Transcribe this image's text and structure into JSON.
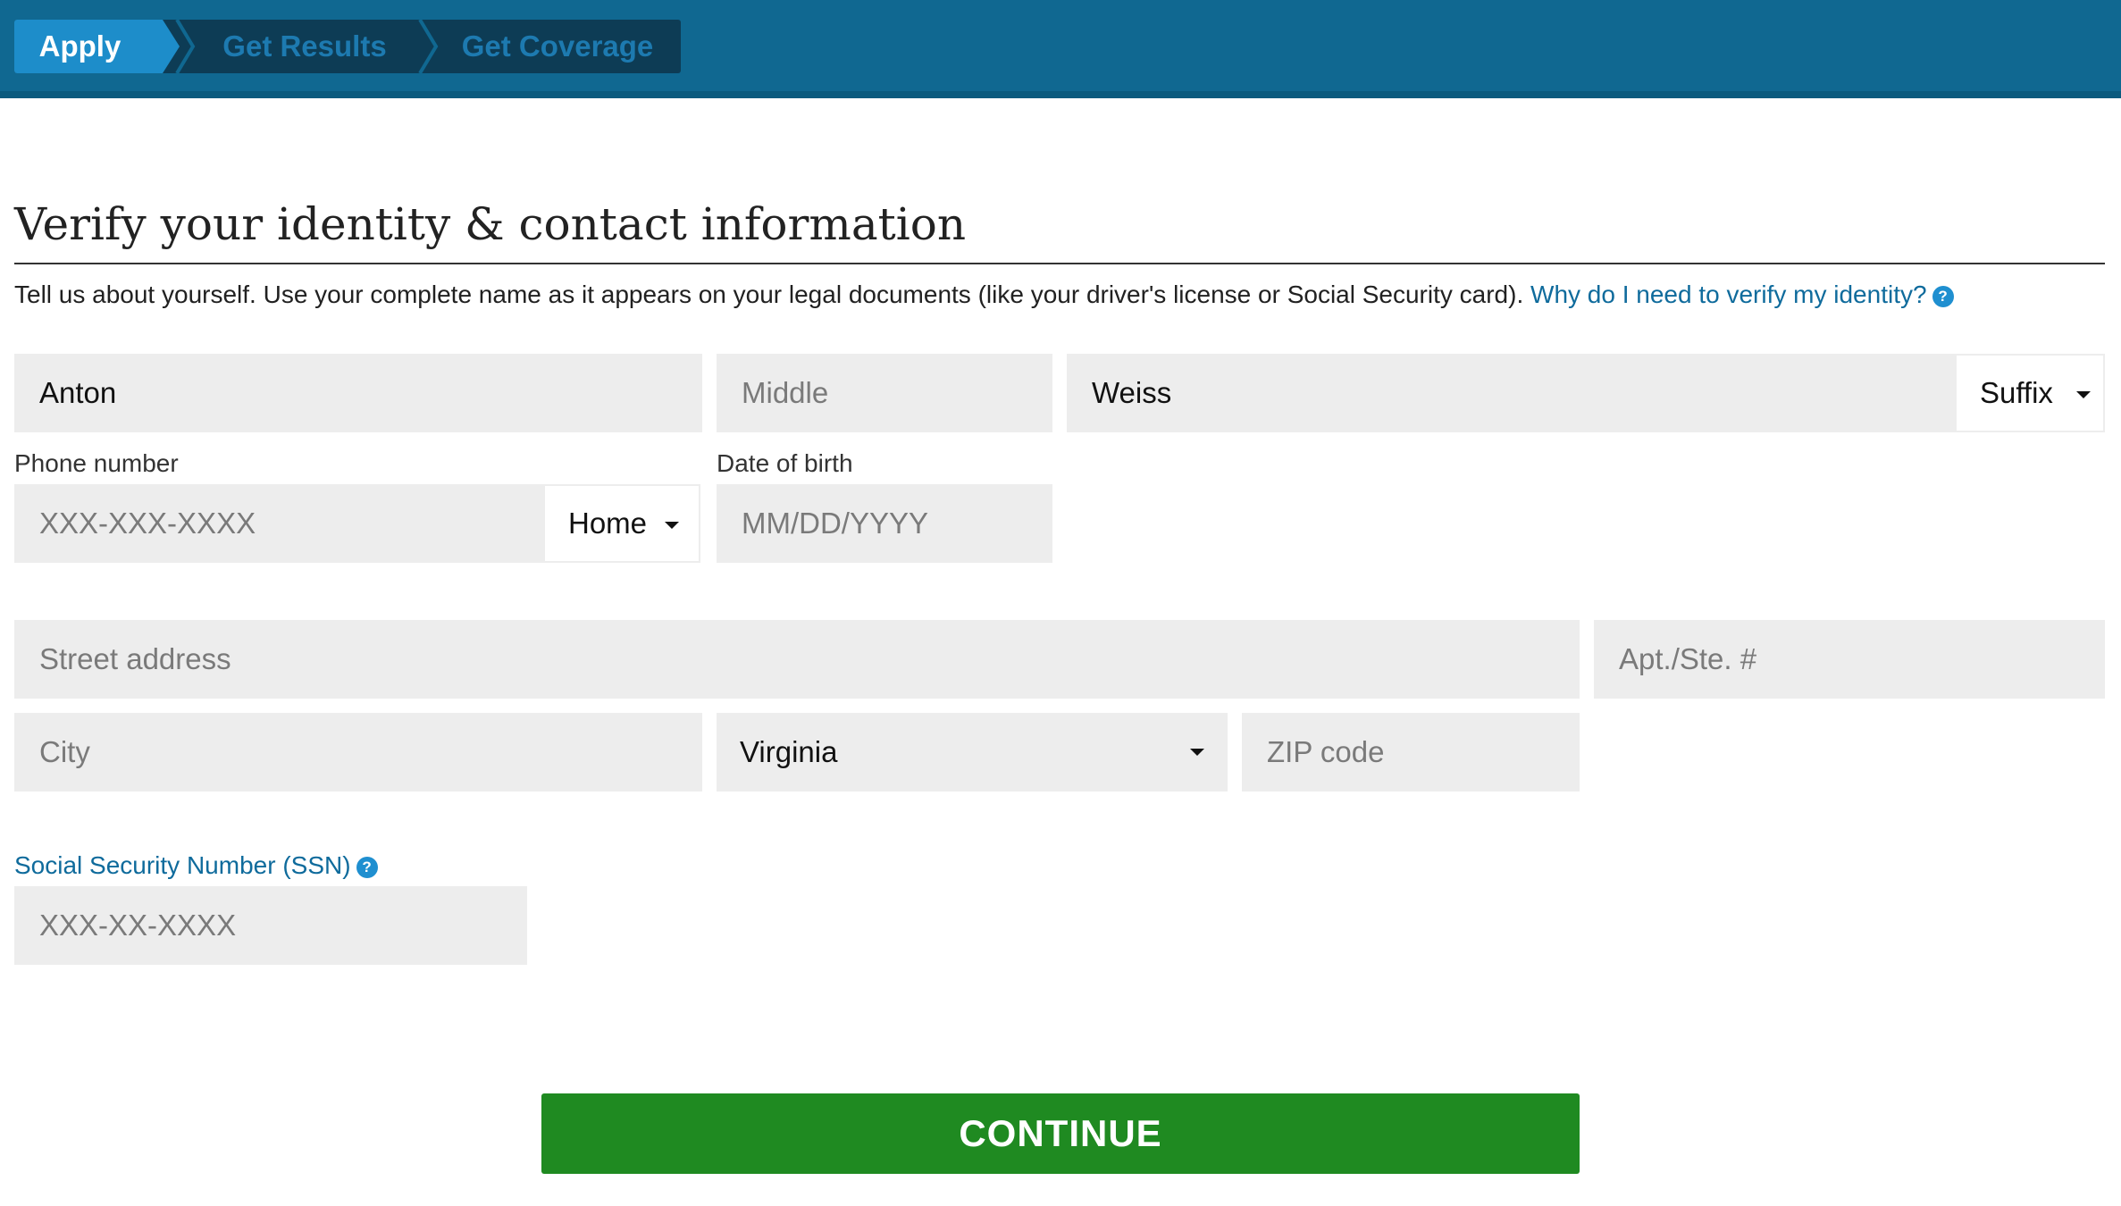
{
  "steps": {
    "apply": "Apply",
    "results": "Get Results",
    "coverage": "Get Coverage"
  },
  "page": {
    "title": "Verify your identity & contact information",
    "intro": "Tell us about yourself. Use your complete name as it appears on your legal documents (like your driver's license or Social Security card).",
    "intro_link": "Why do I need to verify my identity?",
    "help_icon": "question-circle-icon"
  },
  "name": {
    "first_value": "Anton",
    "middle_placeholder": "Middle",
    "last_value": "Weiss",
    "suffix_label": "Suffix"
  },
  "phone": {
    "label": "Phone number",
    "placeholder": "XXX-XXX-XXXX",
    "type_label": "Home"
  },
  "dob": {
    "label": "Date of birth",
    "placeholder": "MM/DD/YYYY"
  },
  "address": {
    "street_placeholder": "Street address",
    "apt_placeholder": "Apt./Ste. #",
    "city_placeholder": "City",
    "state_value": "Virginia",
    "zip_placeholder": "ZIP code"
  },
  "ssn": {
    "label": "Social Security Number (SSN)",
    "placeholder": "XXX-XX-XXXX"
  },
  "actions": {
    "continue_label": "CONTINUE"
  },
  "colors": {
    "header": "#106891",
    "active_step": "#1d8dca",
    "link": "#0f6b9c",
    "continue": "#1f8a21"
  }
}
